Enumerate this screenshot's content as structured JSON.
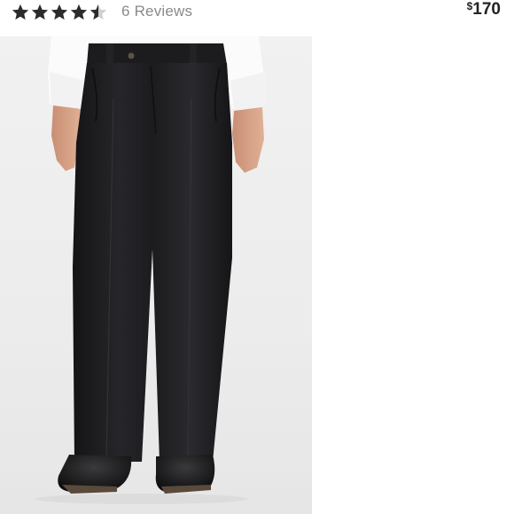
{
  "listing": {
    "rating": {
      "value": 4.5,
      "max": 5,
      "reviews_label": "6 Reviews"
    },
    "price": {
      "currency": "$",
      "amount": "170"
    },
    "photo": {
      "subject": "product-photo"
    },
    "colors": {
      "star_fill": "#2b2b2b",
      "star_empty": "#cfcfcf",
      "reviews_text": "#8a8a8a",
      "price_text": "#222222",
      "pants": "#1f1f22",
      "shirt": "#fbfbfb"
    }
  }
}
